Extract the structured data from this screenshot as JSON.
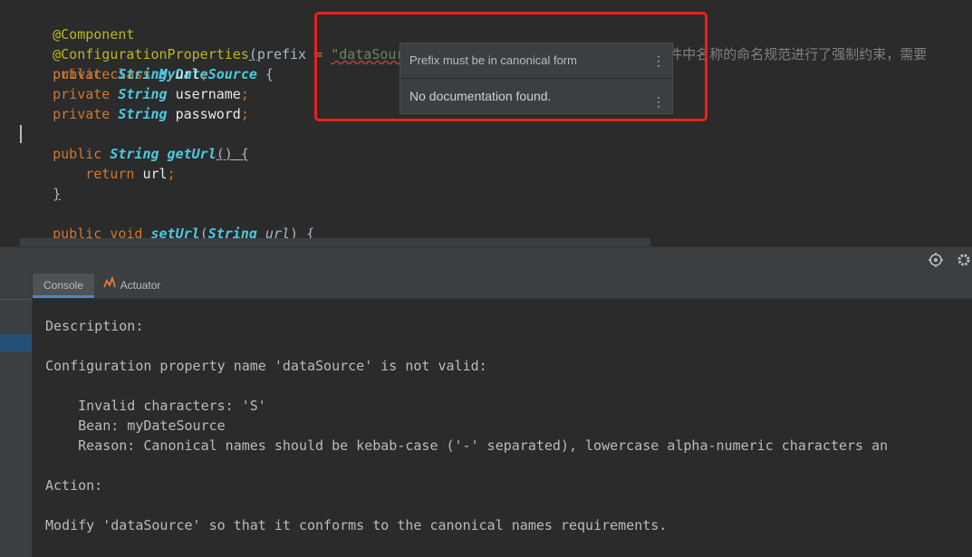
{
  "editor": {
    "lines": [
      "@Component",
      "@ConfigurationProperties(prefix = \"dataSource\")  //spring boot 2.x 中对配置文件中名称的命名规范进行了强制约束，需要",
      "public class MyDateSource {",
      "    private String url;",
      "    private String username;",
      "    private String password;",
      "",
      "    public String getUrl() {",
      "        return url;",
      "    }",
      "",
      "    public void setUrl(String url) {"
    ],
    "l1_ann": "@Component",
    "l2_ann": "@ConfigurationProperties",
    "l2_paren_open": "(",
    "l2_prefix": "prefix",
    "l2_eq": " = ",
    "l2_str": "\"dataSource\"",
    "l2_paren_close": ")",
    "l2_comment": "  //spring boot 2.x 中对配置文件中名称的命名规范进行了强制约束，需要",
    "l3_kw": "public class ",
    "l3_cls": "MyDateSource",
    "l3_brace": " {",
    "l4_kw": "private ",
    "l4_type": "String",
    "l4_name": " url",
    "l5_kw": "private ",
    "l5_type": "String",
    "l5_name": " username",
    "l6_kw": "private ",
    "l6_type": "String",
    "l6_name": " password",
    "semi": ";",
    "l8_kw": "public ",
    "l8_type": "String",
    "l8_fn": " getUrl",
    "l8_parens": "()",
    "l8_brace": " {",
    "l9_kw": "return",
    "l9_name": " url",
    "l10_brace": "}",
    "l12_kw": "public void ",
    "l12_fn": "setUrl",
    "l12_paren_open": "(",
    "l12_type": "String",
    "l12_param": " url",
    "l12_paren_close": ")",
    "l12_brace": " {"
  },
  "tooltip": {
    "title": "Prefix must be in canonical form",
    "body": "No documentation found.",
    "menu_glyph": "⋮"
  },
  "tool_window": {
    "tabs": [
      {
        "label": "Console",
        "active": true
      },
      {
        "label": "Actuator",
        "active": false
      }
    ],
    "icons": [
      "crosshair-icon",
      "gear-icon"
    ]
  },
  "console": {
    "lines": [
      "Description:",
      "",
      "Configuration property name 'dataSource' is not valid:",
      "",
      "    Invalid characters: 'S'",
      "    Bean: myDateSource",
      "    Reason: Canonical names should be kebab-case ('-' separated), lowercase alpha-numeric characters an",
      "",
      "Action:",
      "",
      "Modify 'dataSource' so that it conforms to the canonical names requirements."
    ]
  },
  "colors": {
    "editor_bg": "#2b2b2b",
    "panel_bg": "#3c3f41",
    "keyword": "#cc7832",
    "string": "#6a8759",
    "annotation": "#bbb529",
    "highlight_box": "#e8231b"
  }
}
